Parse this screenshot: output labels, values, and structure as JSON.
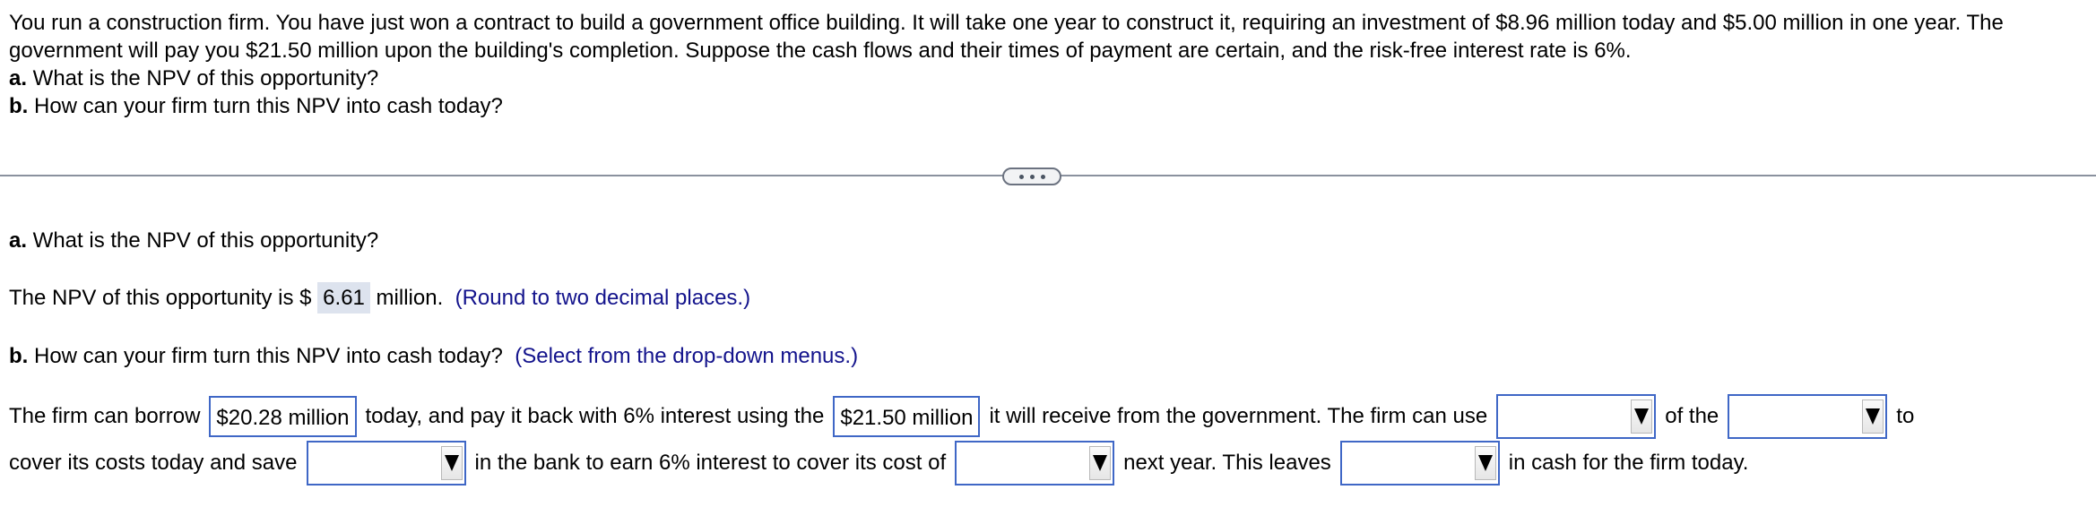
{
  "problem": {
    "paragraph": "You run a construction firm. You have just won a contract to build a government office building. It will take one year to construct it, requiring an investment of $8.96 million today and $5.00 million in one year. The government will pay you $21.50 million upon the building's completion. Suppose the cash flows and their times of payment are certain, and the risk-free interest rate is 6%.",
    "part_a_label": "a.",
    "part_a_question": " What is the NPV of this opportunity?",
    "part_b_label": "b.",
    "part_b_question": " How can your firm turn this NPV into cash today?"
  },
  "divider": {
    "expand_icon": "ellipsis-icon"
  },
  "answer_a": {
    "label": "a.",
    "question": " What is the NPV of this opportunity?",
    "prefix": "The NPV of this opportunity is $ ",
    "value": "6.61",
    "suffix": " million.",
    "hint": "(Round to two decimal places.)"
  },
  "answer_b": {
    "label": "b.",
    "question": " How can your firm turn this NPV into cash today?",
    "hint": "(Select from the drop-down menus.)",
    "row1": {
      "t1": "The firm can borrow",
      "box1": "$20.28 million",
      "t2": "today, and pay it back with 6% interest using the",
      "box2": "$21.50 million",
      "t3": "it will receive from the government. The firm can use",
      "select1": "",
      "t4": "of the",
      "select2": "",
      "t5": "to"
    },
    "row2": {
      "t1": "cover its costs today and save",
      "select3": "",
      "t2": "in the bank to earn 6% interest to cover its cost of",
      "select4": "",
      "t3": "next year. This leaves",
      "select5": "",
      "t4": "in cash for the firm today."
    }
  }
}
